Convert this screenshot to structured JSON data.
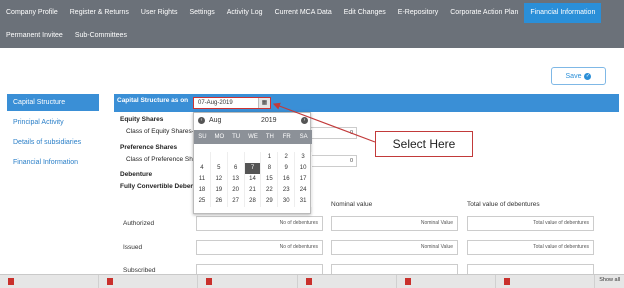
{
  "nav": {
    "row1": [
      "Company Profile",
      "Register & Returns",
      "User Rights",
      "Settings",
      "Activity Log",
      "Current MCA Data",
      "Edit Changes",
      "E-Repository",
      "Corporate Action Plan",
      "Financial Information"
    ],
    "row2": [
      "Permanent Invitee",
      "Sub-Committees"
    ],
    "active": "Financial Information"
  },
  "save_label": "Save",
  "sidebar": {
    "items": [
      "Capital Structure",
      "Principal Activity",
      "Details of subsidiaries",
      "Financial Information"
    ]
  },
  "capital": {
    "title": "Capital Structure as on",
    "date_value": "07-Aug-2019",
    "equity_shares": "Equity Shares",
    "class_equity": "Class of Equity Shares-C",
    "preference_shares": "Preference Shares",
    "class_preference": "Class of Preference Sha",
    "zero": "0",
    "debenture": "Debenture",
    "fully_convertible": "Fully Convertible Debentu"
  },
  "table": {
    "headers": [
      "Nominal value",
      "Total value of debentures"
    ],
    "rows": [
      {
        "label": "Authorized",
        "cells": [
          "No of debentures",
          "Nominal Value",
          "Total value of debentures"
        ]
      },
      {
        "label": "Issued",
        "cells": [
          "No of debentures",
          "Nominal Value",
          "Total value of debentures"
        ]
      },
      {
        "label": "Subscribed",
        "cells": [
          "",
          "",
          ""
        ]
      }
    ]
  },
  "calendar": {
    "month": "Aug",
    "year": "2019",
    "dow": [
      "SU",
      "MO",
      "TU",
      "WE",
      "TH",
      "FR",
      "SA"
    ],
    "weeks": [
      [
        "",
        "",
        "",
        "",
        "1",
        "2",
        "3"
      ],
      [
        "4",
        "5",
        "6",
        "7",
        "8",
        "9",
        "10"
      ],
      [
        "11",
        "12",
        "13",
        "14",
        "15",
        "16",
        "17"
      ],
      [
        "18",
        "19",
        "20",
        "21",
        "22",
        "23",
        "24"
      ],
      [
        "25",
        "26",
        "27",
        "28",
        "29",
        "30",
        "31"
      ]
    ],
    "selected": "7"
  },
  "annotation": "Select Here",
  "taskbar": {
    "show_all": "Show all"
  },
  "colors": {
    "nav_bg": "#6b7179",
    "accent": "#2a8fd8",
    "annotation": "#c23a3a"
  }
}
